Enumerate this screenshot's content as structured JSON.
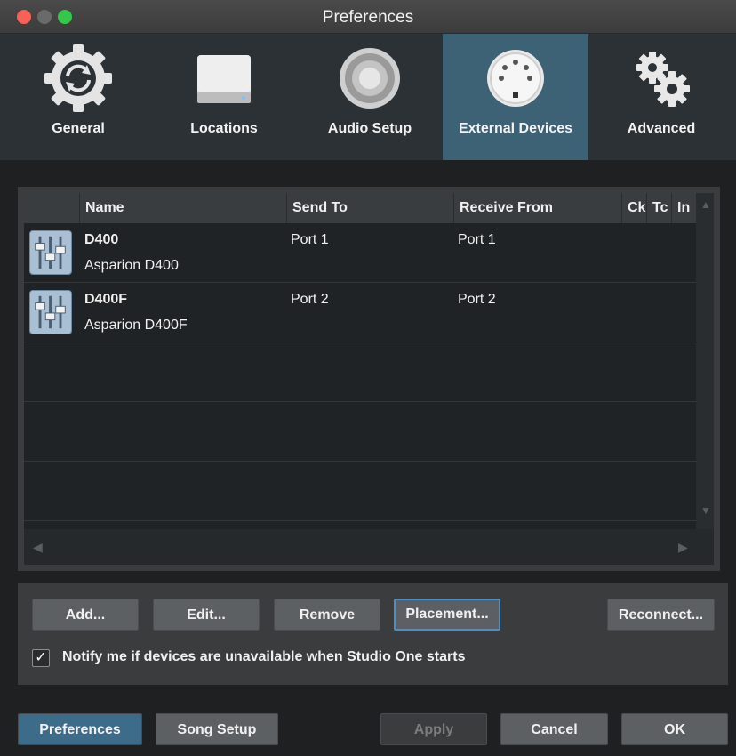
{
  "window": {
    "title": "Preferences"
  },
  "tabs": [
    {
      "label": "General",
      "icon": "gear-sync-icon"
    },
    {
      "label": "Locations",
      "icon": "hard-drive-icon"
    },
    {
      "label": "Audio Setup",
      "icon": "speaker-icon"
    },
    {
      "label": "External Devices",
      "icon": "midi-port-icon",
      "active": true
    },
    {
      "label": "Advanced",
      "icon": "gears-icon"
    }
  ],
  "table": {
    "columns": [
      "Name",
      "Send To",
      "Receive From",
      "Ck",
      "Tc",
      "In"
    ],
    "rows": [
      {
        "name": "D400",
        "model": "Asparion D400",
        "send_to": "Port 1",
        "receive_from": "Port 1"
      },
      {
        "name": "D400F",
        "model": "Asparion D400F",
        "send_to": "Port 2",
        "receive_from": "Port 2"
      }
    ]
  },
  "actions": {
    "add": "Add...",
    "edit": "Edit...",
    "remove": "Remove",
    "placement": "Placement...",
    "reconnect": "Reconnect..."
  },
  "notify": {
    "checked": true,
    "check_mark": "✓",
    "label": "Notify me if devices are unavailable when Studio One starts"
  },
  "footer": {
    "preferences": "Preferences",
    "song_setup": "Song Setup",
    "apply": "Apply",
    "cancel": "Cancel",
    "ok": "OK"
  },
  "colors": {
    "active_tab": "#3d6175",
    "focus_ring": "#4a90c8",
    "close": "#fc5f57",
    "zoom": "#34c84a"
  }
}
